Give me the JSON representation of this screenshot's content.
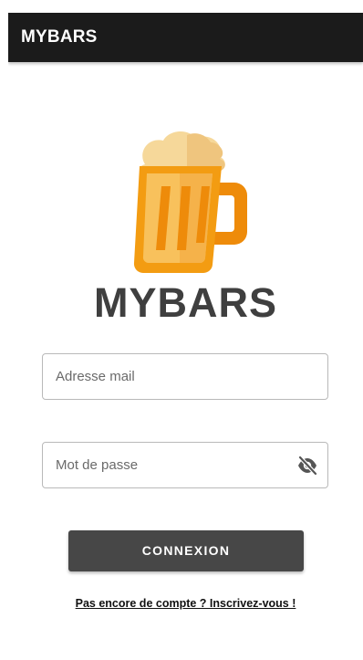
{
  "app_bar": {
    "title": "MYBARS"
  },
  "logo": {
    "icon": "beer-mug-icon",
    "brand_name": "MYBARS"
  },
  "form": {
    "email_placeholder": "Adresse mail",
    "email_value": "",
    "password_placeholder": "Mot de passe",
    "password_value": "",
    "password_toggle_icon": "eye-off-icon",
    "login_label": "CONNEXION",
    "signup_link": "Pas encore de compte ? Inscrivez-vous !"
  },
  "colors": {
    "app_bar": "#1b1b1b",
    "button": "#474747",
    "brand_text": "#3f3f3f",
    "mug_orange": "#f39c12",
    "mug_light": "#f8c15c",
    "foam": "#f6d89a"
  }
}
